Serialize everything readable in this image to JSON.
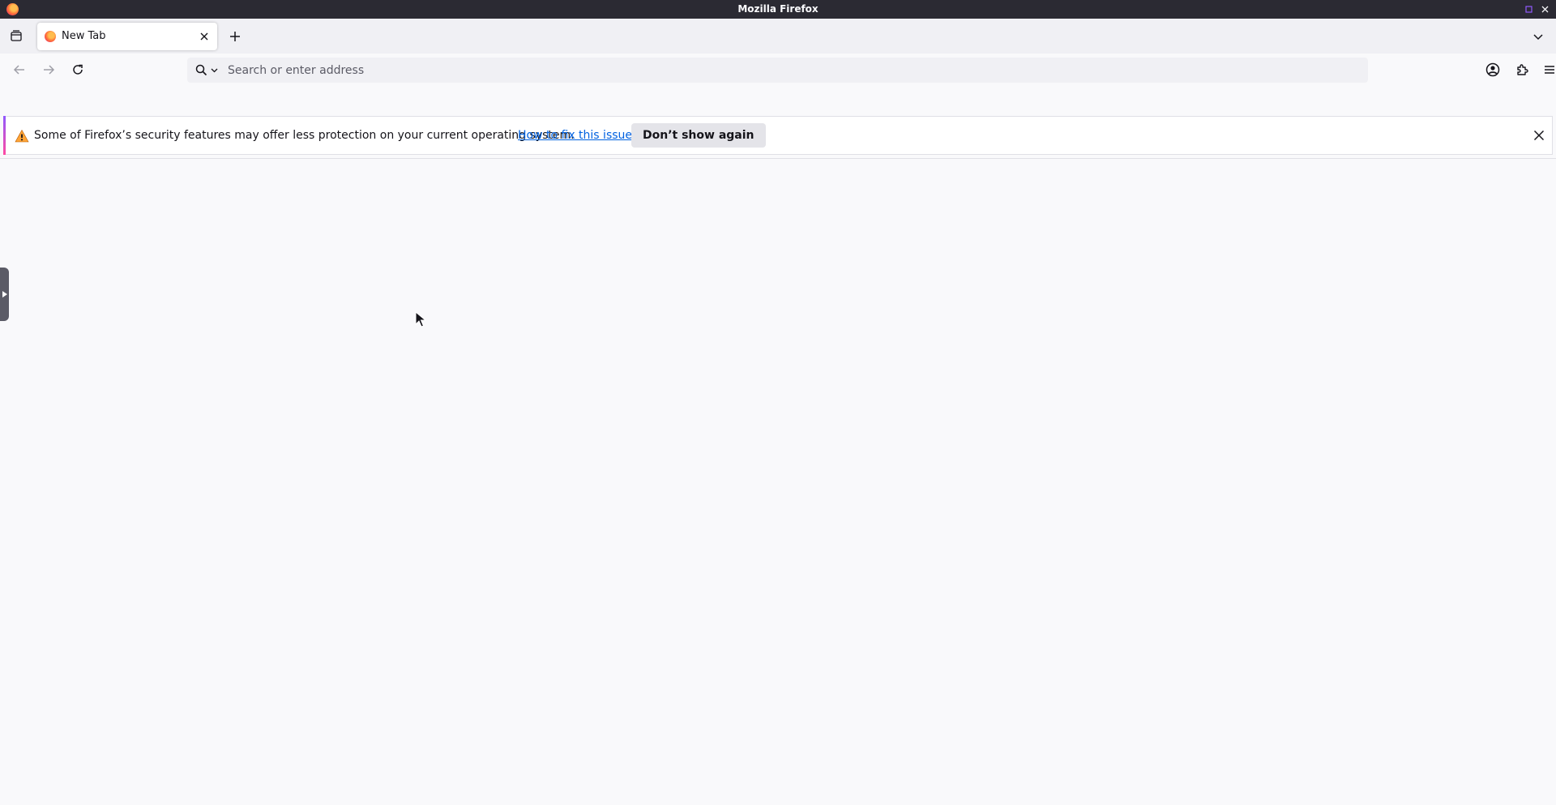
{
  "window": {
    "title": "Mozilla Firefox"
  },
  "tabs": [
    {
      "label": "New Tab",
      "active": true
    }
  ],
  "urlbar": {
    "placeholder": "Search or enter address",
    "value": ""
  },
  "infobar": {
    "message": "Some of Firefox’s security features may offer less protection on your current operating system.",
    "link_label": "How to fix this issue",
    "button_label": "Don’t show again"
  },
  "icons": {
    "app": "firefox-logo-icon",
    "tab_list": "tab-list-icon",
    "new_tab": "plus-icon",
    "all_tabs": "chevron-down-icon",
    "back": "arrow-left-icon",
    "forward": "arrow-right-icon",
    "reload": "reload-icon",
    "search": "search-icon",
    "account": "account-icon",
    "extensions": "puzzle-icon",
    "menu": "hamburger-menu-icon",
    "warning": "warning-icon",
    "close": "close-icon"
  },
  "colors": {
    "accent": "#0061e0",
    "warning": "#ffa436",
    "chrome": "#2b2a33"
  }
}
